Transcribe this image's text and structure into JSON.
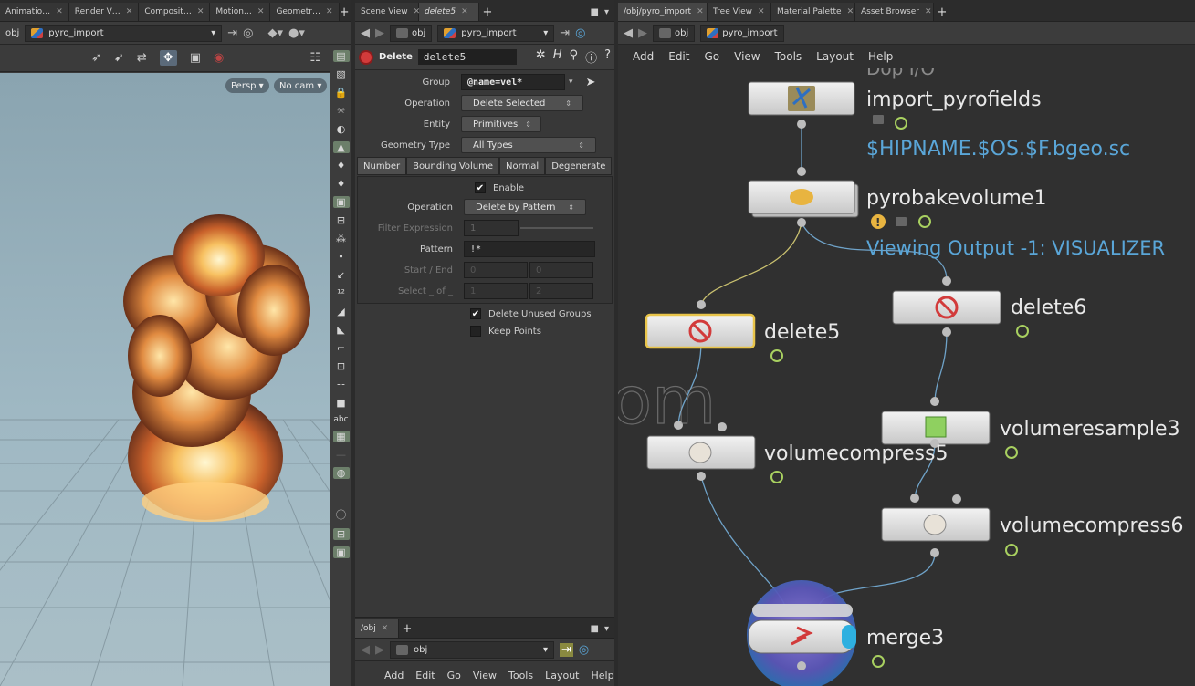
{
  "left_pane": {
    "tabs": [
      "Animatio…",
      "Render V…",
      "Composit…",
      "Motion…",
      "Geometr…"
    ],
    "path": "obj",
    "path2": "pyro_import",
    "view_menu": "Persp ▾",
    "cam_menu": "No cam ▾",
    "shelf_text": "abc"
  },
  "mid_pane": {
    "tabs": [
      "Scene View",
      "delete5"
    ],
    "path": "obj",
    "path2": "pyro_import",
    "node_type": "Delete",
    "node_name": "delete5",
    "group_label": "Group",
    "group_value": "@name=vel*",
    "operation_label": "Operation",
    "operation_value": "Delete Selected",
    "entity_label": "Entity",
    "entity_value": "Primitives",
    "geotype_label": "Geometry Type",
    "geotype_value": "All Types",
    "subtabs": [
      "Number",
      "Bounding Volume",
      "Normal",
      "Degenerate"
    ],
    "enable_label": "Enable",
    "op2_label": "Operation",
    "op2_value": "Delete by Pattern",
    "filter_label": "Filter Expression",
    "filter_value": "1",
    "pattern_label": "Pattern",
    "pattern_value": "!*",
    "range_label": "Start / End",
    "range_start": "0",
    "range_end": "0",
    "select_label": "Select _ of _",
    "select_a": "1",
    "select_b": "2",
    "unused_label": "Delete Unused Groups",
    "keep_label": "Keep Points",
    "bottom_tab": "/obj",
    "bottom_path": "obj",
    "bottom_menu": [
      "Add",
      "Edit",
      "Go",
      "View",
      "Tools",
      "Layout",
      "Help"
    ]
  },
  "right_pane": {
    "tabs": [
      "/obj/pyro_import",
      "Tree View",
      "Material Palette",
      "Asset Browser"
    ],
    "path": "obj",
    "path2": "pyro_import",
    "menu": [
      "Add",
      "Edit",
      "Go",
      "View",
      "Tools",
      "Layout",
      "Help"
    ],
    "nodes": {
      "import_header": "Dop I/O",
      "import_name": "import_pyrofields",
      "import_file": "$HIPNAME.$OS.$F.bgeo.sc",
      "bake_name": "pyrobakevolume1",
      "bake_output": "Viewing Output -1: VISUALIZER",
      "delete5": "delete5",
      "delete6": "delete6",
      "resample": "volumeresample3",
      "compress5": "volumecompress5",
      "compress6": "volumecompress6",
      "merge": "merge3"
    },
    "watermark": "iiivfx.com"
  },
  "colors": {
    "accent_link": "#5aa6d8",
    "selected_outline": "#e8c44a",
    "node_body": "#d8d8d8",
    "wire": "#6fa3c9"
  }
}
